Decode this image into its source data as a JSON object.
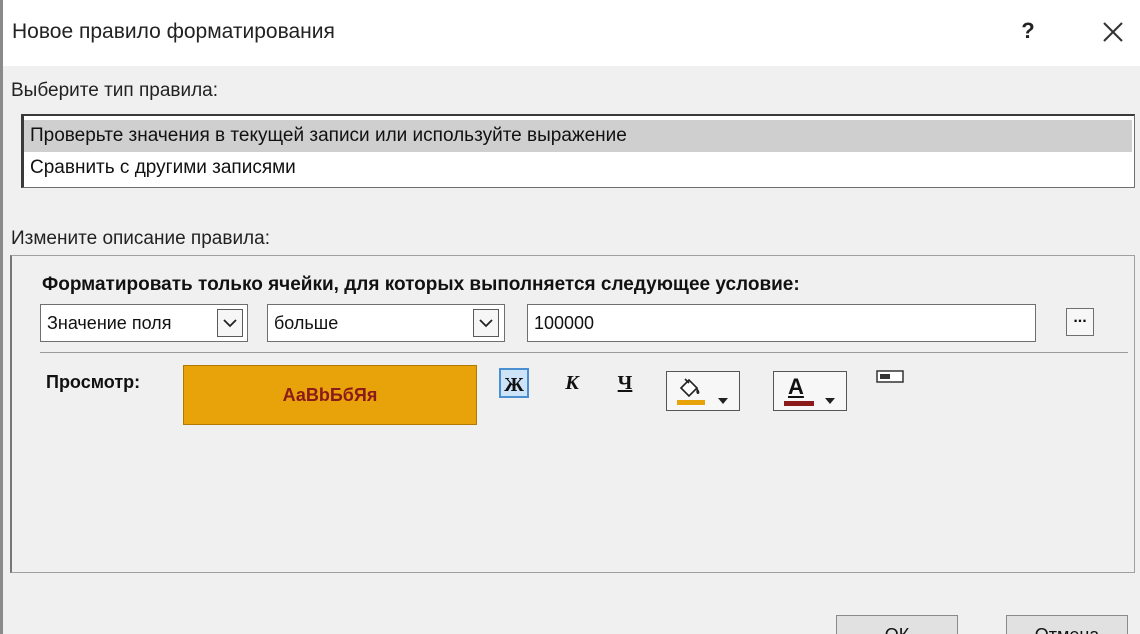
{
  "window": {
    "title": "Новое правило форматирования",
    "help_label": "?",
    "close_icon": "close-icon"
  },
  "rule_type": {
    "label": "Выберите тип правила:",
    "items": [
      {
        "label": "Проверьте значения в текущей записи или используйте выражение",
        "selected": true
      },
      {
        "label": "Сравнить с другими записями",
        "selected": false
      }
    ]
  },
  "description": {
    "label": "Измените описание правила:",
    "condition_title": "Форматировать только ячейки, для которых выполняется следующее условие:",
    "field_select": "Значение поля",
    "operator_select": "больше",
    "value": "100000",
    "builder_button": "..."
  },
  "preview": {
    "label": "Просмотр:",
    "sample_text": "АаBbБбЯя",
    "background_color": "#e8a20a",
    "text_color": "#8b1a1a"
  },
  "formatting": {
    "bold": "Ж",
    "italic": "К",
    "underline": "Ч",
    "fill_color": "#e8a20a",
    "font_color_letter": "A",
    "font_color": "#8b1a1a"
  },
  "buttons": {
    "ok": "ОК",
    "cancel": "Отмена"
  }
}
